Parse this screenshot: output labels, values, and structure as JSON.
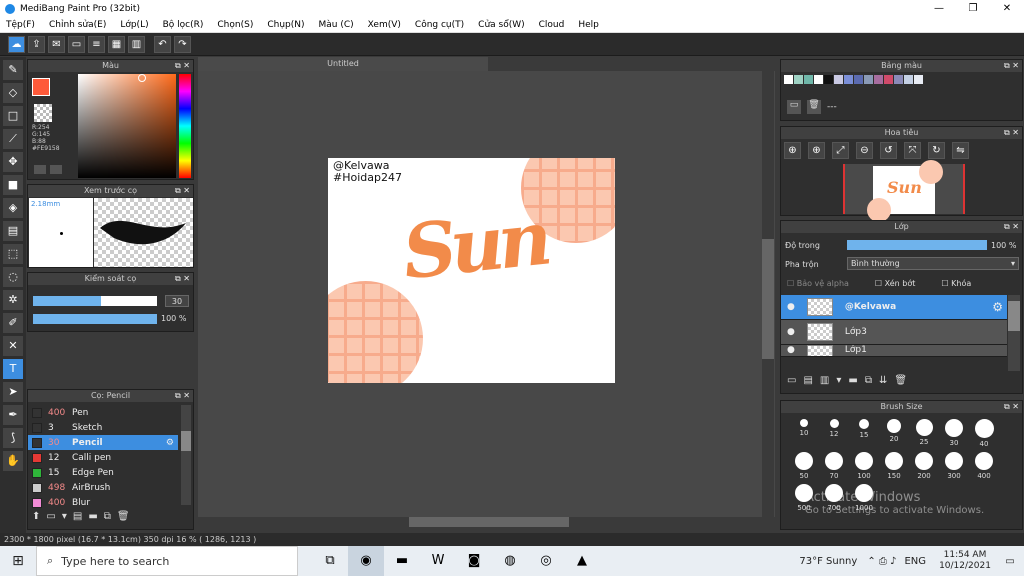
{
  "window": {
    "title": "MediBang Paint Pro (32bit)",
    "minimize": "—",
    "maximize": "❐",
    "close": "✕"
  },
  "menu": [
    "Tệp(F)",
    "Chỉnh sửa(E)",
    "Lớp(L)",
    "Bộ lọc(R)",
    "Chọn(S)",
    "Chụp(N)",
    "Màu (C)",
    "Xem(V)",
    "Công cụ(T)",
    "Cửa sổ(W)",
    "Cloud",
    "Help"
  ],
  "toolbar": {
    "undo": "↶",
    "redo": "↷"
  },
  "panels": {
    "color": {
      "title": "Màu",
      "readout": {
        "r": "R:254",
        "g": "G:145",
        "b": "B:88",
        "hex": "#FE9158"
      },
      "fg": "#FE9158"
    },
    "preview": {
      "title": "Xem trước cọ",
      "size": "2.18mm"
    },
    "control": {
      "title": "Kiểm soát cọ",
      "size_value": "30",
      "opacity_value": "100 %",
      "size_fill": 0.55,
      "opacity_fill": 1.0
    },
    "brush": {
      "title": "Cọ: Pencil",
      "items": [
        {
          "size": "400",
          "name": "Pen",
          "color": "#333333"
        },
        {
          "size": "3",
          "name": "Sketch",
          "color": "#333333"
        },
        {
          "size": "30",
          "name": "Pencil",
          "color": "#333333",
          "active": true
        },
        {
          "size": "12",
          "name": "Calli pen",
          "color": "#e53935"
        },
        {
          "size": "15",
          "name": "Edge Pen",
          "color": "#2fb53a"
        },
        {
          "size": "498",
          "name": "AirBrush",
          "color": "#cccccc"
        },
        {
          "size": "400",
          "name": "Blur",
          "color": "#f28bd6"
        }
      ]
    },
    "palette": {
      "title": "Bảng màu",
      "none": "---",
      "swatches": [
        "#ffffff",
        "#9ed1c3",
        "#6fb7a9",
        "#ffffff",
        "#111111",
        "#c9c9e3",
        "#7b8fd8",
        "#5b6bb1",
        "#8a9ab6",
        "#a76d9f",
        "#d04a6a",
        "#8a8ab8",
        "#c4d0e4",
        "#e8ecf4"
      ]
    },
    "navigator": {
      "title": "Hoa tiêu"
    },
    "layer": {
      "title": "Lớp",
      "opacity_label": "Độ trong",
      "opacity_value": "100 %",
      "blend_label": "Pha trộn",
      "blend_value": "Bình thường",
      "protect_alpha": "Bảo vệ alpha",
      "clipping": "Xén bớt",
      "lock": "Khóa",
      "layers": [
        {
          "name": "@Kelvawa",
          "active": true
        },
        {
          "name": "Lớp3"
        },
        {
          "name": "Lớp1"
        }
      ]
    },
    "brush_size": {
      "title": "Brush Size",
      "sizes": [
        "10",
        "12",
        "15",
        "20",
        "25",
        "30",
        "40",
        "50",
        "70",
        "100",
        "150",
        "200",
        "300",
        "400",
        "500",
        "700",
        "1000"
      ]
    }
  },
  "canvas": {
    "tab": "Untitled",
    "handle": "@Kelvawa",
    "tag": "#Hoidap247",
    "art_text": "Sun"
  },
  "status": "2300 * 1800 pixel   (16.7 * 13.1cm)   350 dpi   16 %   ( 1286, 1213 )",
  "activation": {
    "line1": "Activate Windows",
    "line2": "Go to Settings to activate Windows."
  },
  "taskbar": {
    "search_placeholder": "Type here to search",
    "weather": "73°F  Sunny",
    "lang": "ENG",
    "time": "11:54 AM",
    "date": "10/12/2021"
  }
}
